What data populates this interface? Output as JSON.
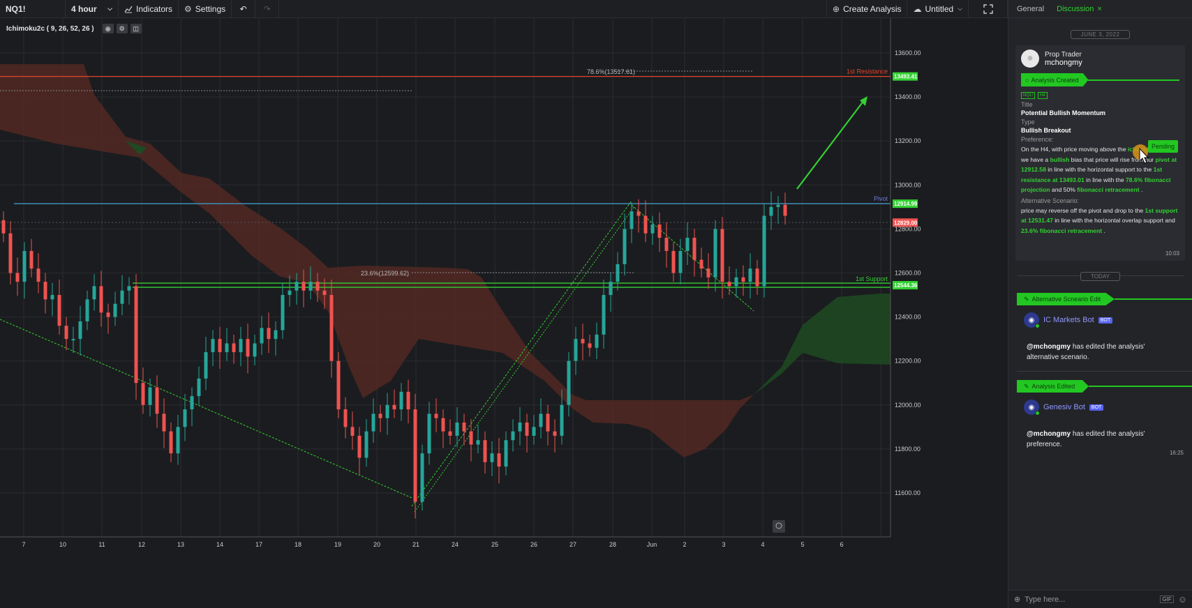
{
  "toolbar": {
    "symbol": "NQ1!",
    "interval": "4 hour",
    "indicators_label": "Indicators",
    "settings_label": "Settings",
    "create_analysis_label": "Create Analysis",
    "untitled_label": "Untitled"
  },
  "study": {
    "label": "Ichimoku2c ( 9, 26, 52, 26 )"
  },
  "chart_data": {
    "type": "candlestick",
    "price_axis": [
      13600,
      13400,
      13200,
      13000,
      12800,
      12600,
      12400,
      12200,
      12000,
      11800,
      11600
    ],
    "price_axis_labels": [
      "13600.00",
      "13400.00",
      "13200.00",
      "13000.00",
      "12800.00",
      "12600.00",
      "12400.00",
      "12200.00",
      "12000.00",
      "11800.00",
      "11600.00"
    ],
    "x_labels": [
      "7",
      "10",
      "11",
      "12",
      "13",
      "14",
      "17",
      "18",
      "19",
      "20",
      "21",
      "24",
      "25",
      "26",
      "27",
      "28",
      "Jun",
      "2",
      "3",
      "4",
      "5",
      "6"
    ],
    "ylim": [
      11520,
      13760
    ],
    "levels": [
      {
        "name": "1st Resistance",
        "value": 13493.41,
        "badge": "13493.41",
        "color": "#e0452e"
      },
      {
        "name": "Pivot",
        "value": 12914.99,
        "badge": "12914.99",
        "color": "#3e8fb8"
      },
      {
        "name": "1st Support",
        "value": 12544.36,
        "badge": "12544.36",
        "color": "#33d133"
      }
    ],
    "last_price_badge": "12829.00",
    "fib_labels": [
      {
        "text": "78.6%(13517.61)",
        "value": 13517.61
      },
      {
        "text": "23.6%(12599.62)",
        "value": 12599.62
      }
    ]
  },
  "panel": {
    "tabs": [
      "General",
      "Discussion"
    ],
    "active_tab": "Discussion",
    "date_separator": "JUNE 3, 2022",
    "today_separator": "TODAY",
    "card": {
      "role": "Prop Trader",
      "username": "mchongmy",
      "banner": "Analysis Created",
      "tags": [
        "NQ1!",
        "H4"
      ],
      "status": "Pending",
      "title_label": "Title",
      "title_value": "Potential Bullish Momentum",
      "type_label": "Type",
      "type_value": "Bullish Breakout",
      "pref_label": "Preference:",
      "pref_parts": [
        "On the H4, with price moving above the ",
        "ichimoku cloud",
        ", we have a ",
        "bullish",
        " bias that price will rise from our ",
        "pivot at 12912.58",
        " in line with the horizontal support to the ",
        "1st resistance at 13493.01",
        " in line with the ",
        "78.6% fibonacci projection",
        " and 50% ",
        "fibonacci retracement",
        " ."
      ],
      "alt_label": "Alternative Scenario:",
      "alt_parts": [
        "price may reverse off the pivot and drop to the ",
        "1st support at 12531.47",
        " in line with the horizontal overlap support and ",
        "23.6% fibonacci retracement",
        " ."
      ],
      "time": "10:03"
    },
    "events": [
      {
        "banner": "Alternative Scneario Edit",
        "bot": "IC Markets Bot",
        "badge": "BOT",
        "mention": "@mchongmy",
        "msg": " has edited the analysis' alternative scenario.",
        "time": ""
      },
      {
        "banner": "Analysis Edited",
        "bot": "Genesiv Bot",
        "badge": "BOT",
        "mention": "@mchongmy",
        "msg": " has edited the analysis' preference.",
        "time": "16:25"
      }
    ],
    "input_placeholder": "Type here...",
    "gif_label": "GIF"
  }
}
